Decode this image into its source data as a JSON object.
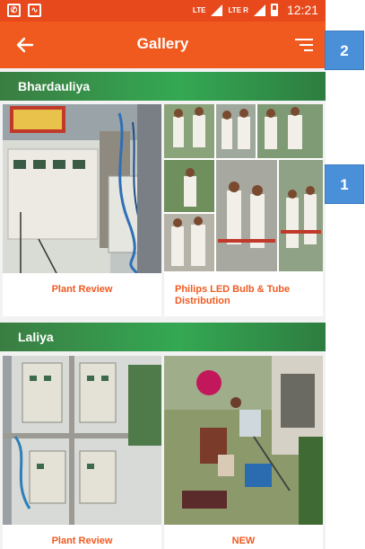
{
  "statusbar": {
    "lte1": "LTE",
    "lte2": "LTE R",
    "time": "12:21"
  },
  "appbar": {
    "back_icon": "arrow-left-icon",
    "title": "Gallery",
    "filter_icon": "sort-filter-icon"
  },
  "sections": [
    {
      "name": "Bhardauliya",
      "items": [
        {
          "caption": "Plant Review"
        },
        {
          "caption": "Philips LED Bulb & Tube Distribution"
        }
      ]
    },
    {
      "name": "Laliya",
      "items": [
        {
          "caption": "Plant Review"
        },
        {
          "caption": "NEW"
        }
      ]
    }
  ],
  "annotations": [
    "1",
    "2"
  ],
  "colors": {
    "appbar": "#f15a1f",
    "section": "#34a853",
    "caption": "#f15a1f",
    "badge": "#4a90d9"
  }
}
